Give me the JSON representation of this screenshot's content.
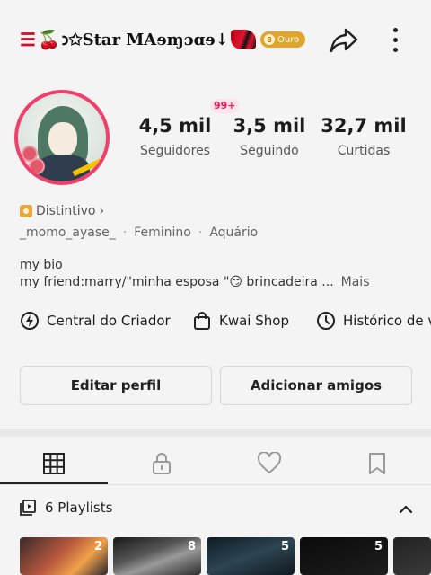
{
  "header": {
    "title": "☰🍒𐑮✫☾Star Mᴀɘɱɓɑɘ↓❣",
    "title_text": "𐑮✩Star MAɘɱɔɑɘ↓",
    "level_badge": "Ouro",
    "share_icon": "share-arrow-icon",
    "more_icon": "more-vertical-icon"
  },
  "profile": {
    "notification_badge": "99+",
    "stats": [
      {
        "value": "4,5 mil",
        "label": "Seguidores"
      },
      {
        "value": "3,5 mil",
        "label": "Seguindo"
      },
      {
        "value": "32,7 mil",
        "label": "Curtidas"
      }
    ],
    "distintivo": "Distintivo",
    "username": "_momo_ayase_",
    "gender": "Feminino",
    "sign": "Aquário",
    "bio_line1": "my bio",
    "bio_line2": "my friend:marry/\"minha esposa \"😏 brincadeira ...",
    "bio_more": "Mais"
  },
  "shortcuts": [
    {
      "label": "Central do Criador",
      "icon": "lightning-circle-icon"
    },
    {
      "label": "Kwai Shop",
      "icon": "shopping-bag-icon"
    },
    {
      "label": "Histórico de v",
      "icon": "clock-icon"
    }
  ],
  "buttons": {
    "edit": "Editar perfil",
    "add": "Adicionar amigos"
  },
  "tabs": [
    {
      "icon": "grid-icon",
      "active": true
    },
    {
      "icon": "lock-icon",
      "active": false
    },
    {
      "icon": "heart-icon",
      "active": false
    },
    {
      "icon": "bookmark-icon",
      "active": false
    }
  ],
  "playlists": {
    "label": "6 Playlists",
    "thumb_counts": [
      "2",
      "8",
      "5",
      "5"
    ]
  },
  "colors": {
    "avatar_ring": "#ef3f6b",
    "ouro_badge": "#e0a52a",
    "badge_text": "#e61e5a"
  }
}
